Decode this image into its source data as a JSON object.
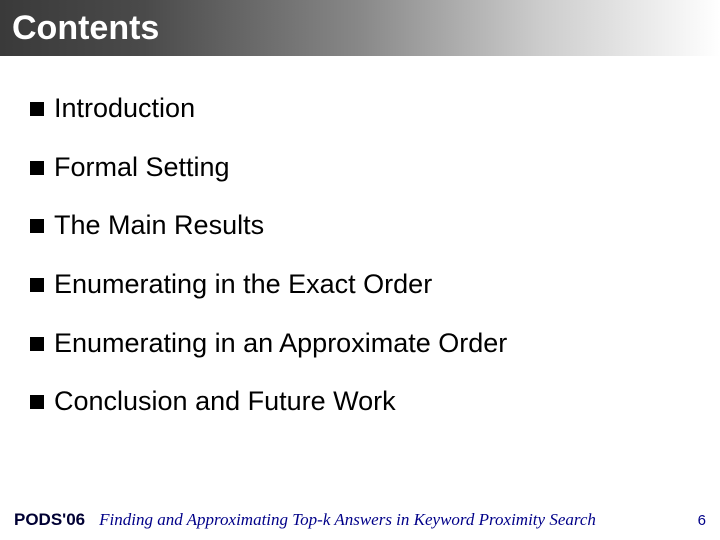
{
  "header": {
    "title": "Contents"
  },
  "contents": {
    "items": [
      {
        "label": "Introduction"
      },
      {
        "label": "Formal Setting"
      },
      {
        "label": "The Main Results"
      },
      {
        "label": "Enumerating in the Exact Order"
      },
      {
        "label": "Enumerating in an Approximate Order"
      },
      {
        "label": "Conclusion and Future Work"
      }
    ]
  },
  "footer": {
    "badge": "PODS'06",
    "title": "Finding and Approximating Top-k Answers in Keyword Proximity Search",
    "page": "6"
  }
}
